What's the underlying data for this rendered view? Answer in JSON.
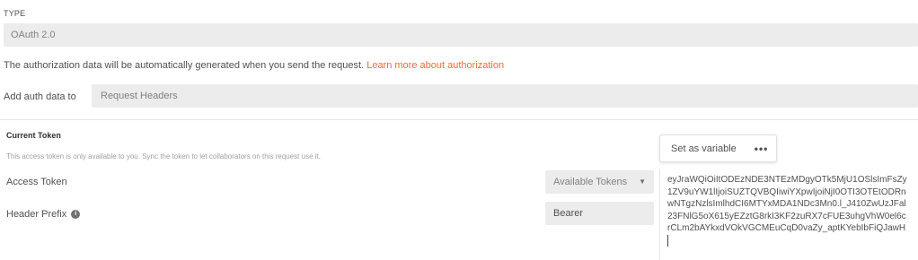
{
  "type_section": {
    "label": "TYPE",
    "selected": "OAuth 2.0"
  },
  "info": {
    "text": "The authorization data will be automatically generated when you send the request.",
    "link": "Learn more about authorization"
  },
  "add_auth": {
    "label": "Add auth data to",
    "selected": "Request Headers"
  },
  "current_token": {
    "title": "Current Token",
    "description": "This access token is only available to you. Sync the token to let collaborators on this request use it.",
    "set_as_variable": "Set as variable",
    "more": "•••",
    "access_token_label": "Access Token",
    "available_tokens": "Available Tokens",
    "available_caret": "▼",
    "header_prefix_label": "Header Prefix",
    "header_prefix_info_icon": "i",
    "header_prefix_value": "Bearer",
    "token_lines": [
      "eyJraWQiOiItODEzNDE3NTEzMDgyOTk5MjU1OSlsImFsZy",
      "1ZV9uYW1lIjoiSUZTQVBQIiwiYXpwIjoiNjI0OTI3OTEtODRn",
      "wNTgzNzlsImlhdCI6MTYxMDA1NDc3Mn0.l_J410ZwUzJFal",
      "23FNlG5oX615yEZztG8rkI3KF2zuRX7cFUE3uhgVhW0el6c",
      "rCLm2bAYkxdVOkVGCMEuCqD0vaZy_aptKYebIbFiQJawH"
    ]
  },
  "colors": {
    "link": "#f26b3a",
    "field_bg": "#ececec"
  }
}
